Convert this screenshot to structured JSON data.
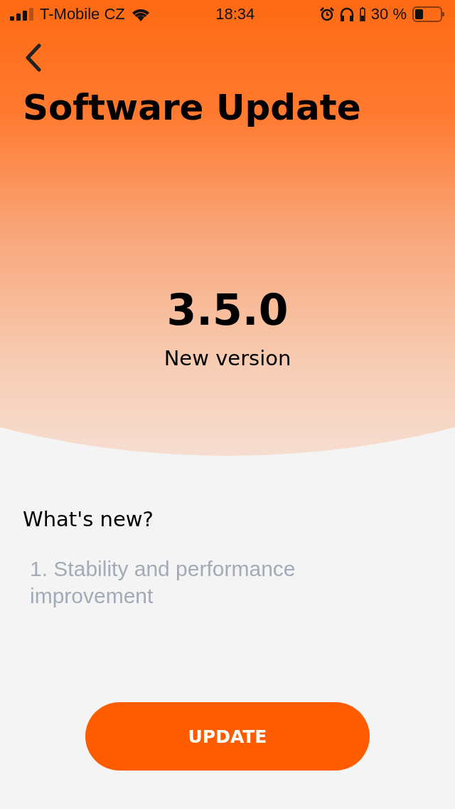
{
  "status_bar": {
    "carrier": "T-Mobile CZ",
    "time": "18:34",
    "battery_text": "30 %"
  },
  "header": {
    "title": "Software Update",
    "version": "3.5.0",
    "version_caption": "New version"
  },
  "whats_new": {
    "heading": "What's new?",
    "items": [
      "1. Stability and performance improvement"
    ]
  },
  "button": {
    "label": "UPDATE"
  }
}
